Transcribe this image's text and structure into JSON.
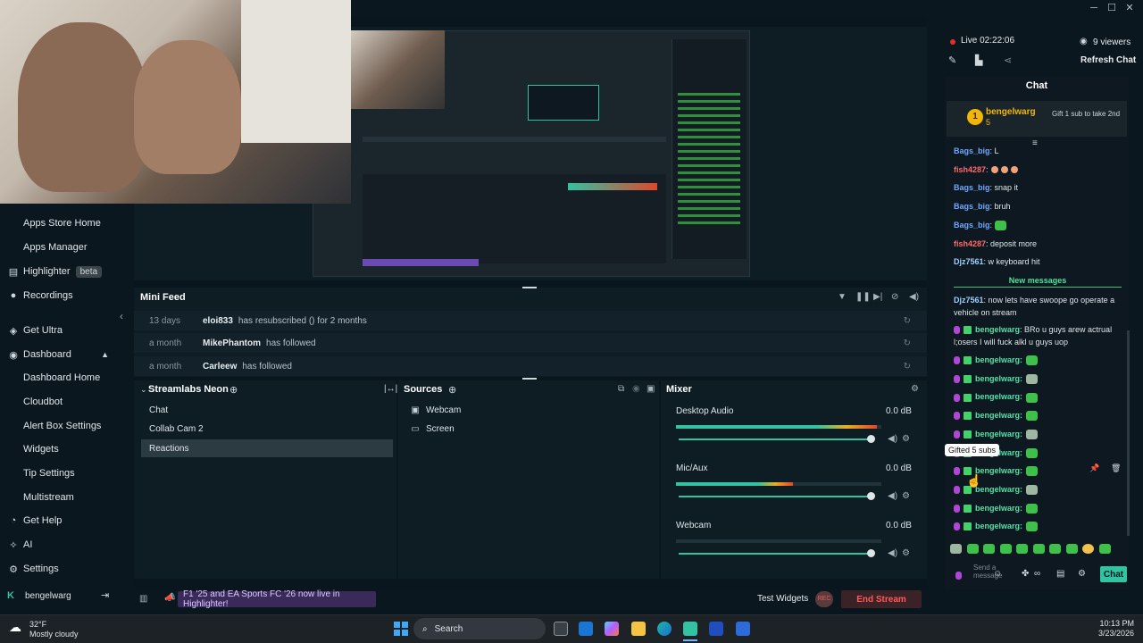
{
  "window": {
    "minimize": "─",
    "maximize": "☐",
    "close": "✕"
  },
  "sidebar": {
    "items": [
      {
        "label": "Apps Store Home",
        "icon": "store-icon",
        "sub": true
      },
      {
        "label": "Apps Manager",
        "icon": "manager-icon",
        "sub": true
      },
      {
        "label": "Highlighter",
        "icon": "highlighter-icon",
        "sub": false,
        "badge": "beta"
      },
      {
        "label": "Recordings",
        "icon": "recordings-icon",
        "sub": false
      },
      {
        "label": "Get Ultra",
        "icon": "ultra-icon",
        "sub": false
      },
      {
        "label": "Dashboard",
        "icon": "dashboard-icon",
        "sub": false
      },
      {
        "label": "Dashboard Home",
        "icon": "",
        "sub": true
      },
      {
        "label": "Cloudbot",
        "icon": "",
        "sub": true
      },
      {
        "label": "Alert Box Settings",
        "icon": "",
        "sub": true
      },
      {
        "label": "Widgets",
        "icon": "",
        "sub": true
      },
      {
        "label": "Tip Settings",
        "icon": "",
        "sub": true
      },
      {
        "label": "Multistream",
        "icon": "",
        "sub": true
      },
      {
        "label": "Get Help",
        "icon": "help-icon",
        "sub": false
      },
      {
        "label": "AI",
        "icon": "ai-icon",
        "sub": false
      },
      {
        "label": "Settings",
        "icon": "gear-icon",
        "sub": false
      }
    ],
    "user": "bengelwarg"
  },
  "minifeed": {
    "title": "Mini Feed",
    "rows": [
      {
        "time": "13 days",
        "user": "eloi833",
        "action": "has resubscribed () for 2 months"
      },
      {
        "time": "a month",
        "user": "MikePhantom",
        "action": "has followed"
      },
      {
        "time": "a month",
        "user": "Carleew",
        "action": "has followed"
      }
    ]
  },
  "scenes": {
    "title": "Streamlabs Neon",
    "items": [
      "Chat",
      "Collab Cam 2",
      "Reactions"
    ],
    "active": "Reactions"
  },
  "sources": {
    "title": "Sources",
    "items": [
      {
        "label": "Webcam",
        "icon": "camera-icon"
      },
      {
        "label": "Screen",
        "icon": "monitor-icon"
      }
    ]
  },
  "mixer": {
    "title": "Mixer",
    "channels": [
      {
        "name": "Desktop Audio",
        "db": "0.0 dB",
        "level": 0.98
      },
      {
        "name": "Mic/Aux",
        "db": "0.0 dB",
        "level": 0.57
      },
      {
        "name": "Webcam",
        "db": "0.0 dB",
        "level": 0.0
      }
    ]
  },
  "bottombar": {
    "news": "F1 '25 and EA Sports FC '26 now live in Highlighter!",
    "test_widgets": "Test Widgets",
    "rec": "REC",
    "end_stream": "End Stream"
  },
  "chat": {
    "live_label": "Live 02:22:06",
    "viewers": "9 viewers",
    "refresh": "Refresh Chat",
    "title": "Chat",
    "pinned_user": "bengelwarg",
    "pinned_count": "5",
    "pinned_note": "Gift 1 sub to take 2nd",
    "messages": [
      {
        "user": "Bags_big",
        "text": ": L",
        "color": "n1"
      },
      {
        "user": "fish4287",
        "text": ":",
        "color": "n2"
      },
      {
        "user": "Bags_big",
        "text": ": snap it",
        "color": "n1"
      },
      {
        "user": "Bags_big",
        "text": ": bruh",
        "color": "n1"
      },
      {
        "user": "Bags_big",
        "text": ":",
        "color": "n1"
      },
      {
        "user": "fish4287",
        "text": ": deposit more",
        "color": "n2"
      },
      {
        "user": "Djz7561",
        "text": ": w keyboard hit",
        "color": "n3"
      }
    ],
    "new_messages": "New messages",
    "after": [
      {
        "user": "Djz7561",
        "text": ": now lets have swoope go operate a vehicle on stream",
        "color": "n3"
      },
      {
        "user": "bengelwarg",
        "text": ": BRo u guys arew actrual l;osers I will fuck alkl u guys uop",
        "color": "n4"
      }
    ],
    "bengel_label": "bengelwarg:",
    "tooltip": "Gifted 5 subs",
    "input_placeholder": "Send a message",
    "send": "Chat"
  },
  "taskbar": {
    "temp": "32°F",
    "weather": "Mostly cloudy",
    "search": "Search",
    "time": "10:13 PM",
    "date": "3/23/2026"
  }
}
